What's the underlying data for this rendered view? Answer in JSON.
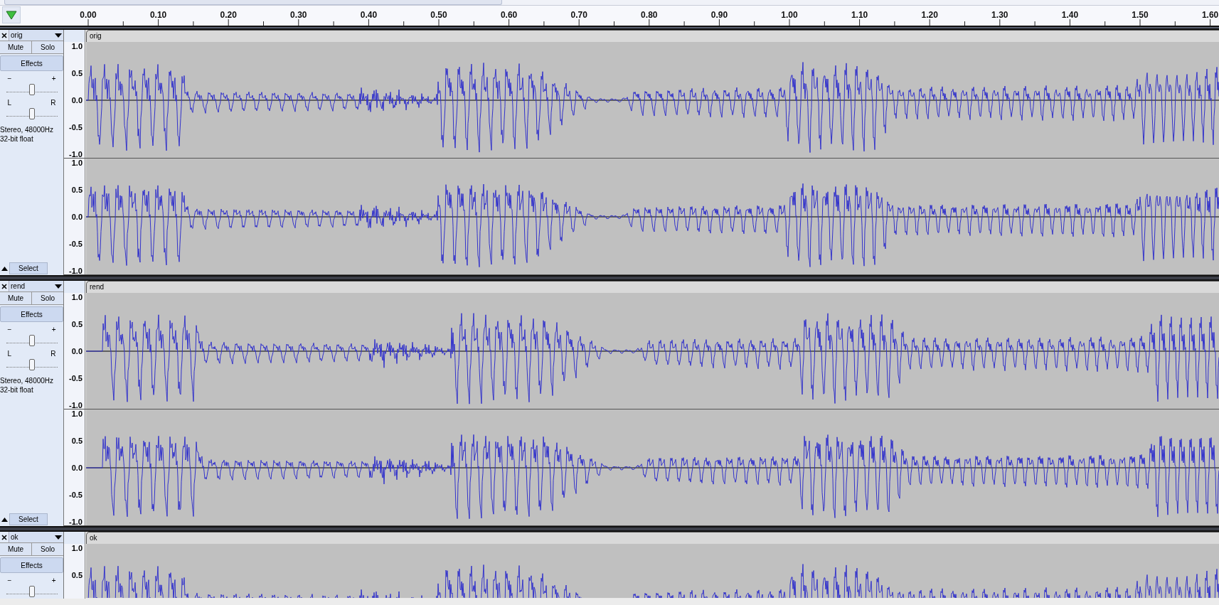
{
  "ruler": {
    "ticks": [
      "0.00",
      "0.10",
      "0.20",
      "0.30",
      "0.40",
      "0.50",
      "0.60",
      "0.70",
      "0.80",
      "0.90",
      "1.00",
      "1.10",
      "1.20",
      "1.30",
      "1.40",
      "1.50",
      "1.60"
    ]
  },
  "tracks": [
    {
      "name": "orig",
      "clip_title": "orig",
      "mute": "Mute",
      "solo": "Solo",
      "effects": "Effects",
      "gain": {
        "minus": "−",
        "plus": "+",
        "level": 0.5
      },
      "pan": {
        "left": "L",
        "right": "R",
        "level": 0.5
      },
      "info": [
        "Stereo, 48000Hz",
        "32-bit float"
      ],
      "select": "Select",
      "channels": [
        {
          "axis": [
            "1.0",
            "0.5",
            "0.0",
            "-0.5",
            "-1.0"
          ]
        },
        {
          "axis": [
            "1.0",
            "0.5",
            "0.0",
            "-0.5",
            "-1.0"
          ]
        }
      ]
    },
    {
      "name": "rend",
      "clip_title": "rend",
      "mute": "Mute",
      "solo": "Solo",
      "effects": "Effects",
      "gain": {
        "minus": "−",
        "plus": "+",
        "level": 0.5
      },
      "pan": {
        "left": "L",
        "right": "R",
        "level": 0.5
      },
      "info": [
        "Stereo, 48000Hz",
        "32-bit float"
      ],
      "select": "Select",
      "channels": [
        {
          "axis": [
            "1.0",
            "0.5",
            "0.0",
            "-0.5",
            "-1.0"
          ]
        },
        {
          "axis": [
            "1.0",
            "0.5",
            "0.0",
            "-0.5",
            "-1.0"
          ]
        }
      ]
    },
    {
      "name": "ok",
      "clip_title": "ok",
      "mute": "Mute",
      "solo": "Solo",
      "effects": "Effects",
      "gain": {
        "minus": "−",
        "plus": "+",
        "level": 0.5
      },
      "channels": [
        {
          "axis": [
            "1.0",
            "0.5"
          ]
        }
      ]
    }
  ]
}
